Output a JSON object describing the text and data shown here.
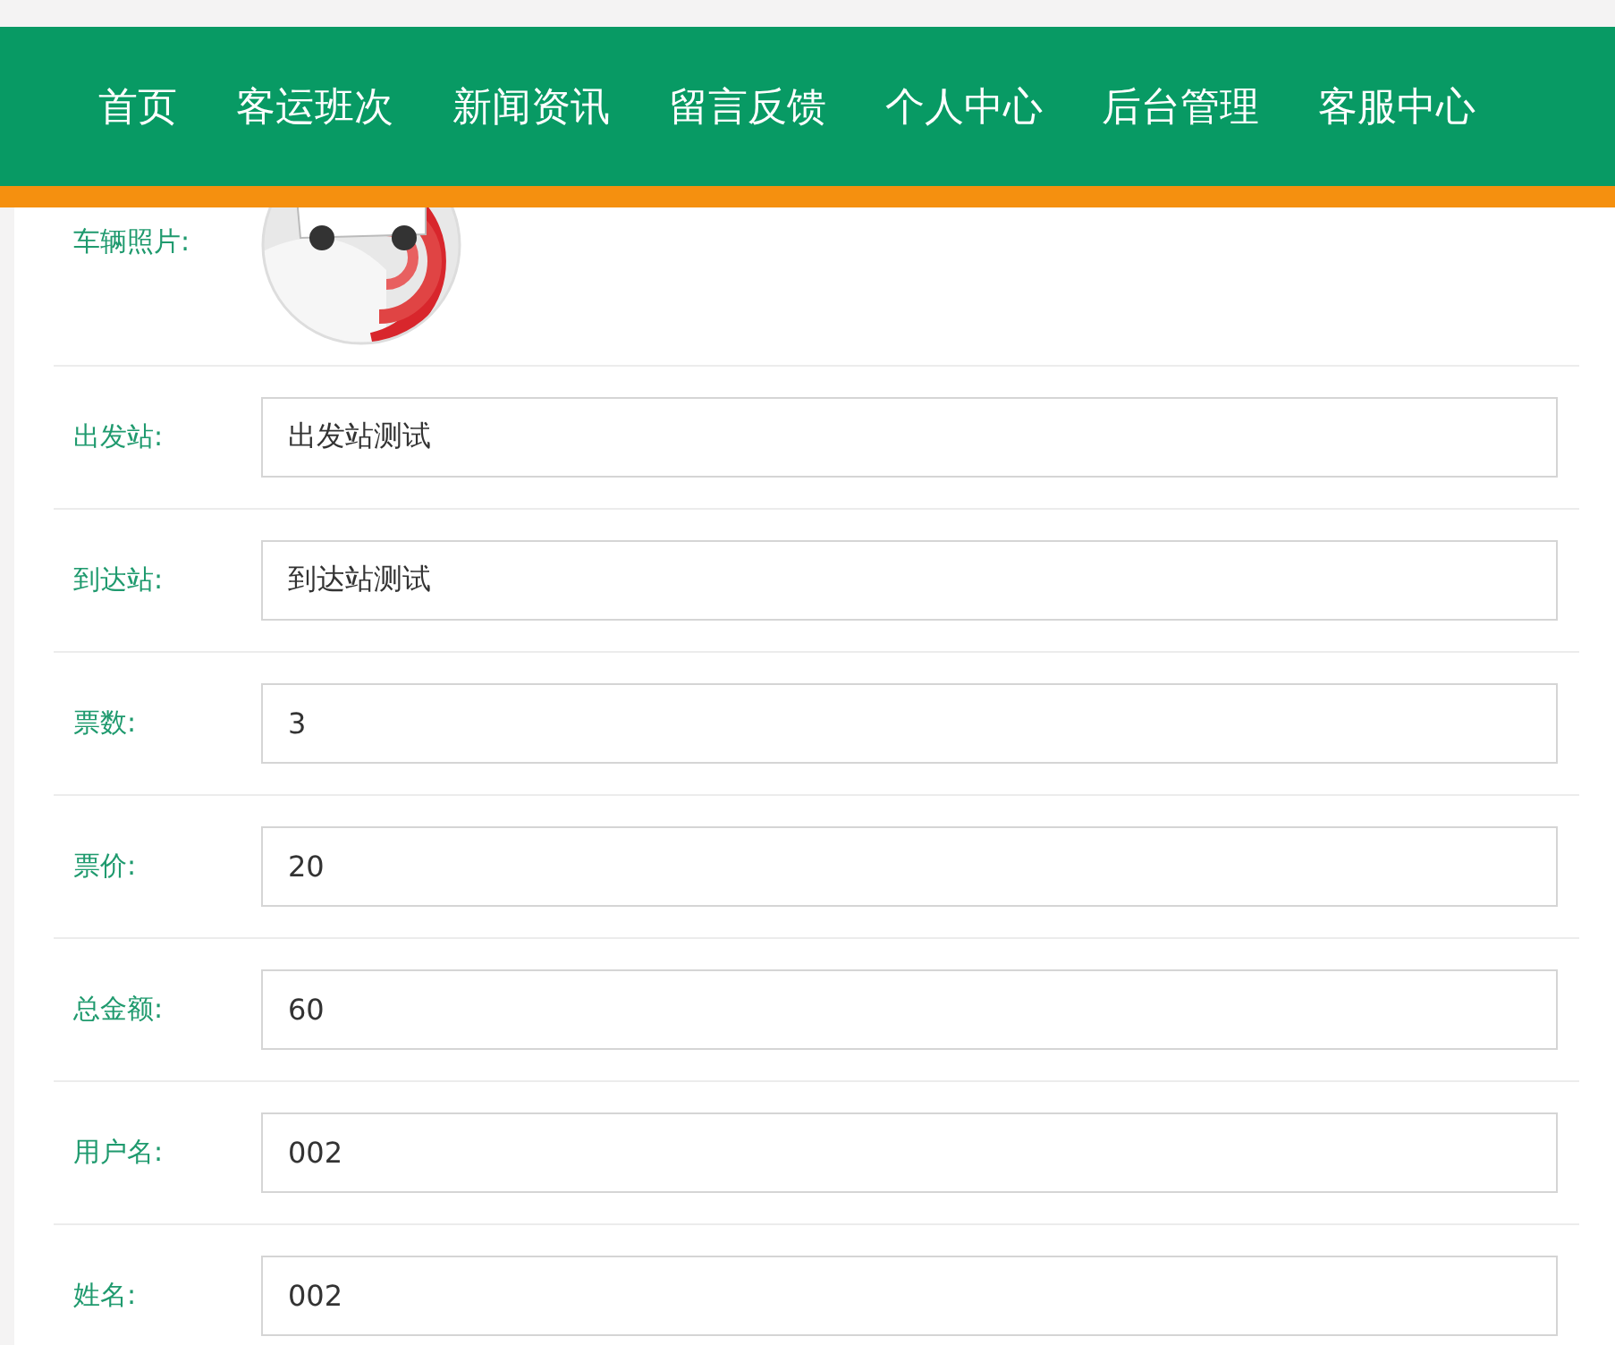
{
  "nav": [
    {
      "label": "首页"
    },
    {
      "label": "客运班次"
    },
    {
      "label": "新闻资讯"
    },
    {
      "label": "留言反馈"
    },
    {
      "label": "个人中心"
    },
    {
      "label": "后台管理"
    },
    {
      "label": "客服中心"
    }
  ],
  "photo": {
    "label": "车辆照片:",
    "kind": "picture"
  },
  "fields": [
    {
      "label": "出发站:",
      "value": "出发站测试"
    },
    {
      "label": "到达站:",
      "value": "到达站测试"
    },
    {
      "label": "票数:",
      "value": "3"
    },
    {
      "label": "票价:",
      "value": "20"
    },
    {
      "label": "总金额:",
      "value": "60"
    },
    {
      "label": "用户名:",
      "value": "002"
    },
    {
      "label": "姓名:",
      "value": "002"
    }
  ]
}
